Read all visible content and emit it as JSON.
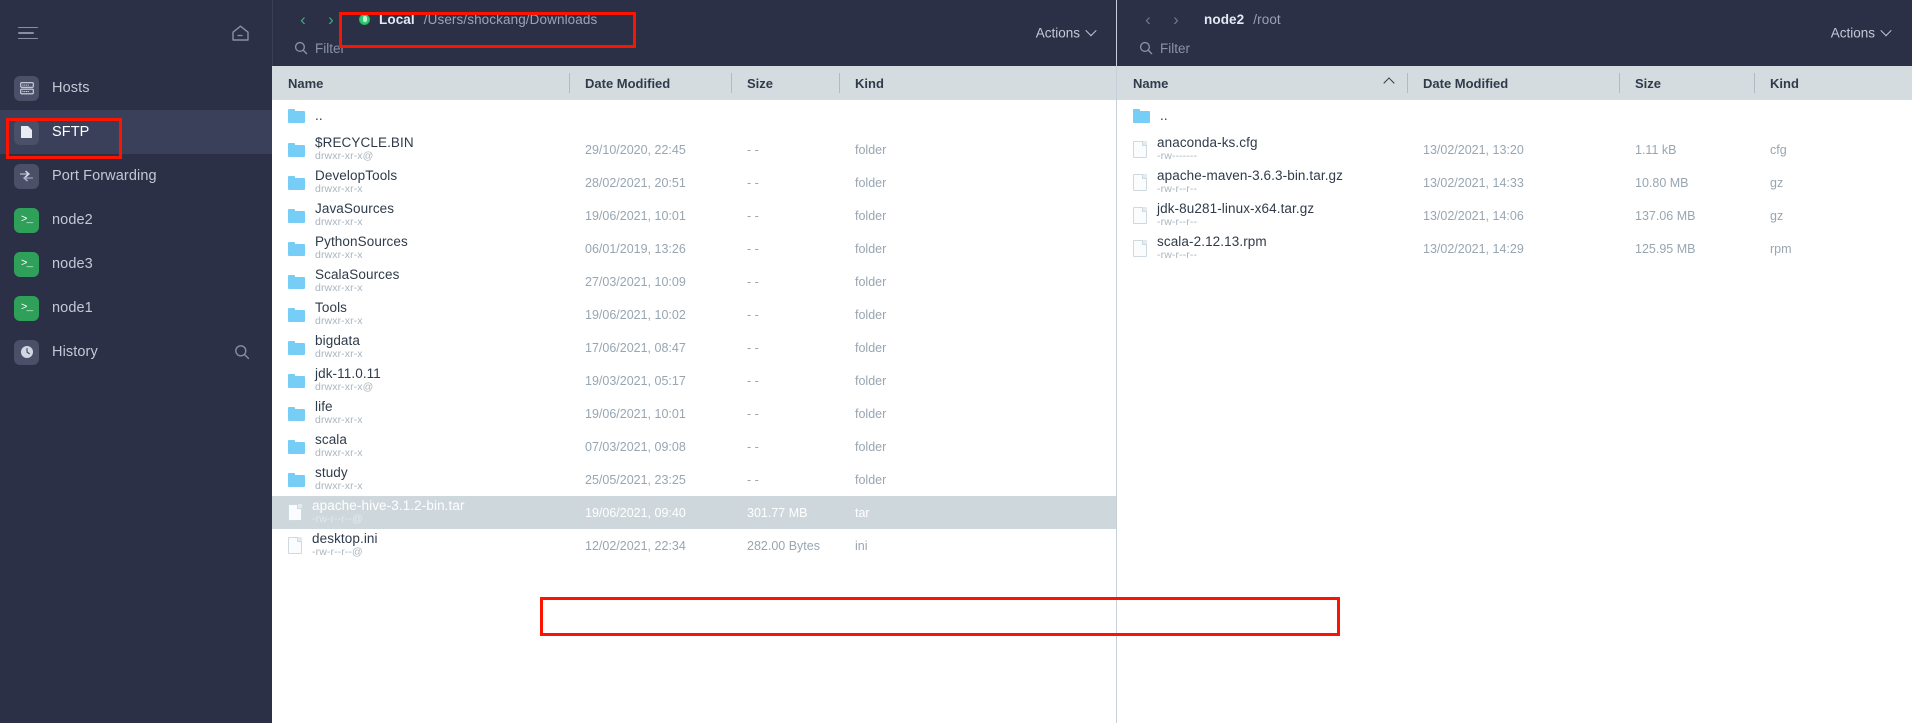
{
  "sidebar": {
    "menu_icon": "hamburger-icon",
    "home_icon": "home-icon",
    "items": [
      {
        "label": "Hosts",
        "icon": "server-icon",
        "active": false
      },
      {
        "label": "SFTP",
        "icon": "file-icon",
        "active": true
      },
      {
        "label": "Port Forwarding",
        "icon": "port-forwarding-icon",
        "active": false
      },
      {
        "label": "node2",
        "icon": "terminal-icon",
        "active": false
      },
      {
        "label": "node3",
        "icon": "terminal-icon",
        "active": false
      },
      {
        "label": "node1",
        "icon": "terminal-icon",
        "active": false
      },
      {
        "label": "History",
        "icon": "clock-icon",
        "active": false
      }
    ]
  },
  "left_pane": {
    "host": "Local",
    "path": "/Users/shockang/Downloads",
    "status_color": "#2ecc71",
    "filter_placeholder": "Filter",
    "actions_label": "Actions",
    "columns": [
      "Name",
      "Date Modified",
      "Size",
      "Kind"
    ],
    "rows": [
      {
        "name": "..",
        "perm": "",
        "date": "",
        "size": "",
        "kind": "",
        "type": "folder",
        "selected": false
      },
      {
        "name": "$RECYCLE.BIN",
        "perm": "drwxr-xr-x@",
        "date": "29/10/2020, 22:45",
        "size": "- -",
        "kind": "folder",
        "type": "folder",
        "selected": false
      },
      {
        "name": "DevelopTools",
        "perm": "drwxr-xr-x",
        "date": "28/02/2021, 20:51",
        "size": "- -",
        "kind": "folder",
        "type": "folder",
        "selected": false
      },
      {
        "name": "JavaSources",
        "perm": "drwxr-xr-x",
        "date": "19/06/2021, 10:01",
        "size": "- -",
        "kind": "folder",
        "type": "folder",
        "selected": false
      },
      {
        "name": "PythonSources",
        "perm": "drwxr-xr-x",
        "date": "06/01/2019, 13:26",
        "size": "- -",
        "kind": "folder",
        "type": "folder",
        "selected": false
      },
      {
        "name": "ScalaSources",
        "perm": "drwxr-xr-x",
        "date": "27/03/2021, 10:09",
        "size": "- -",
        "kind": "folder",
        "type": "folder",
        "selected": false
      },
      {
        "name": "Tools",
        "perm": "drwxr-xr-x",
        "date": "19/06/2021, 10:02",
        "size": "- -",
        "kind": "folder",
        "type": "folder",
        "selected": false
      },
      {
        "name": "bigdata",
        "perm": "drwxr-xr-x",
        "date": "17/06/2021, 08:47",
        "size": "- -",
        "kind": "folder",
        "type": "folder",
        "selected": false
      },
      {
        "name": "jdk-11.0.11",
        "perm": "drwxr-xr-x@",
        "date": "19/03/2021, 05:17",
        "size": "- -",
        "kind": "folder",
        "type": "folder",
        "selected": false
      },
      {
        "name": "life",
        "perm": "drwxr-xr-x",
        "date": "19/06/2021, 10:01",
        "size": "- -",
        "kind": "folder",
        "type": "folder",
        "selected": false
      },
      {
        "name": "scala",
        "perm": "drwxr-xr-x",
        "date": "07/03/2021, 09:08",
        "size": "- -",
        "kind": "folder",
        "type": "folder",
        "selected": false
      },
      {
        "name": "study",
        "perm": "drwxr-xr-x",
        "date": "25/05/2021, 23:25",
        "size": "- -",
        "kind": "folder",
        "type": "folder",
        "selected": false
      },
      {
        "name": "apache-hive-3.1.2-bin.tar",
        "perm": "-rw-r--r--@",
        "date": "19/06/2021, 09:40",
        "size": "301.77 MB",
        "kind": "tar",
        "type": "file",
        "selected": true
      },
      {
        "name": "desktop.ini",
        "perm": "-rw-r--r--@",
        "date": "12/02/2021, 22:34",
        "size": "282.00 Bytes",
        "kind": "ini",
        "type": "file",
        "selected": false
      }
    ]
  },
  "right_pane": {
    "host": "node2",
    "path": "/root",
    "filter_placeholder": "Filter",
    "actions_label": "Actions",
    "columns": [
      "Name",
      "Date Modified",
      "Size",
      "Kind"
    ],
    "sorted_column": "Name",
    "sort_direction": "asc",
    "rows": [
      {
        "name": "..",
        "perm": "",
        "date": "",
        "size": "",
        "kind": "",
        "type": "folder",
        "selected": false
      },
      {
        "name": "anaconda-ks.cfg",
        "perm": "-rw-------",
        "date": "13/02/2021, 13:20",
        "size": "1.11 kB",
        "kind": "cfg",
        "type": "file",
        "selected": false
      },
      {
        "name": "apache-maven-3.6.3-bin.tar.gz",
        "perm": "-rw-r--r--",
        "date": "13/02/2021, 14:33",
        "size": "10.80 MB",
        "kind": "gz",
        "type": "file",
        "selected": false
      },
      {
        "name": "jdk-8u281-linux-x64.tar.gz",
        "perm": "-rw-r--r--",
        "date": "13/02/2021, 14:06",
        "size": "137.06 MB",
        "kind": "gz",
        "type": "file",
        "selected": false
      },
      {
        "name": "scala-2.12.13.rpm",
        "perm": "-rw-r--r--",
        "date": "13/02/2021, 14:29",
        "size": "125.95 MB",
        "kind": "rpm",
        "type": "file",
        "selected": false
      }
    ]
  },
  "annotations": {
    "color": "#fb1500",
    "boxes": [
      "sftp-sidebar-item",
      "local-path-breadcrumb",
      "node2-path-breadcrumb",
      "selected-file-row"
    ]
  }
}
